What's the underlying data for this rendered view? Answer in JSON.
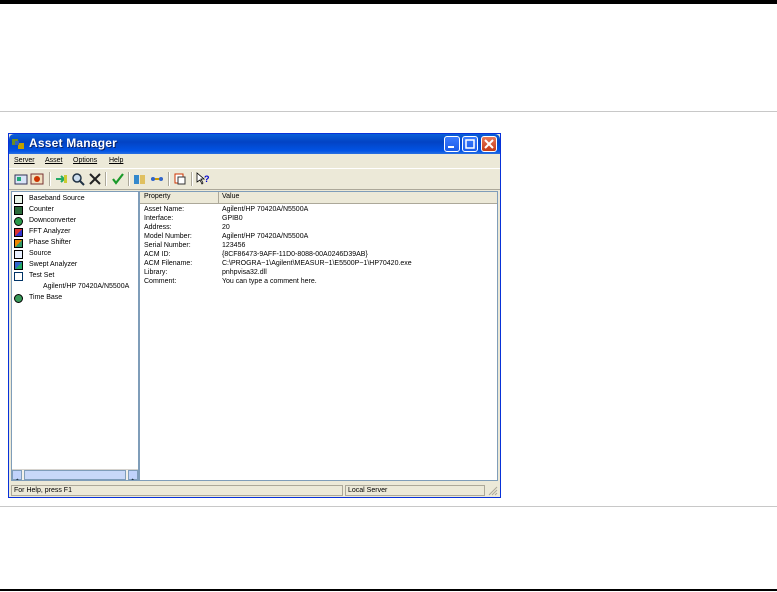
{
  "window": {
    "title": "Asset Manager",
    "status_help": "For Help, press F1",
    "status_server": "Local Server"
  },
  "menu": [
    "Server",
    "Asset",
    "Options",
    "Help"
  ],
  "tree": [
    {
      "label": "Baseband Source",
      "icon": "baseband-source-icon",
      "indent": 0
    },
    {
      "label": "Counter",
      "icon": "counter-icon",
      "indent": 0
    },
    {
      "label": "Downconverter",
      "icon": "downconverter-icon",
      "indent": 0
    },
    {
      "label": "FFT Analyzer",
      "icon": "fft-analyzer-icon",
      "indent": 0
    },
    {
      "label": "Phase Shifter",
      "icon": "phase-shifter-icon",
      "indent": 0
    },
    {
      "label": "Source",
      "icon": "source-icon",
      "indent": 0
    },
    {
      "label": "Swept Analyzer",
      "icon": "swept-analyzer-icon",
      "indent": 0
    },
    {
      "label": "Test Set",
      "icon": "test-set-icon",
      "indent": 0
    },
    {
      "label": "Agilent/HP 70420A/N5500A",
      "icon": "",
      "indent": 1
    },
    {
      "label": "Time Base",
      "icon": "time-base-icon",
      "indent": 0
    }
  ],
  "list": {
    "headers": [
      "Property",
      "Value"
    ],
    "rows": [
      {
        "property": "Asset Name:",
        "value": "Agilent/HP 70420A/N5500A"
      },
      {
        "property": "Interface:",
        "value": "GPIB0"
      },
      {
        "property": "Address:",
        "value": "20"
      },
      {
        "property": "Model Number:",
        "value": "Agilent/HP 70420A/N5500A"
      },
      {
        "property": "Serial Number:",
        "value": "123456"
      },
      {
        "property": "ACM ID:",
        "value": "{8CF86473-9AFF-11D0-8088-00A0246D39AB}"
      },
      {
        "property": "ACM Filename:",
        "value": "C:\\PROGRA~1\\Agilent\\MEASUR~1\\E5500P~1\\HP70420.exe"
      },
      {
        "property": "Library:",
        "value": "pnhpvisa32.dll"
      },
      {
        "property": "Comment:",
        "value": "You can type a comment here."
      }
    ]
  },
  "toolbar": [
    "new-asset-icon",
    "delete-asset-icon",
    "add-icon",
    "search-icon",
    "remove-icon",
    "check-icon",
    "configure-icon",
    "connect-icon",
    "copy-icon",
    "help-icon"
  ]
}
